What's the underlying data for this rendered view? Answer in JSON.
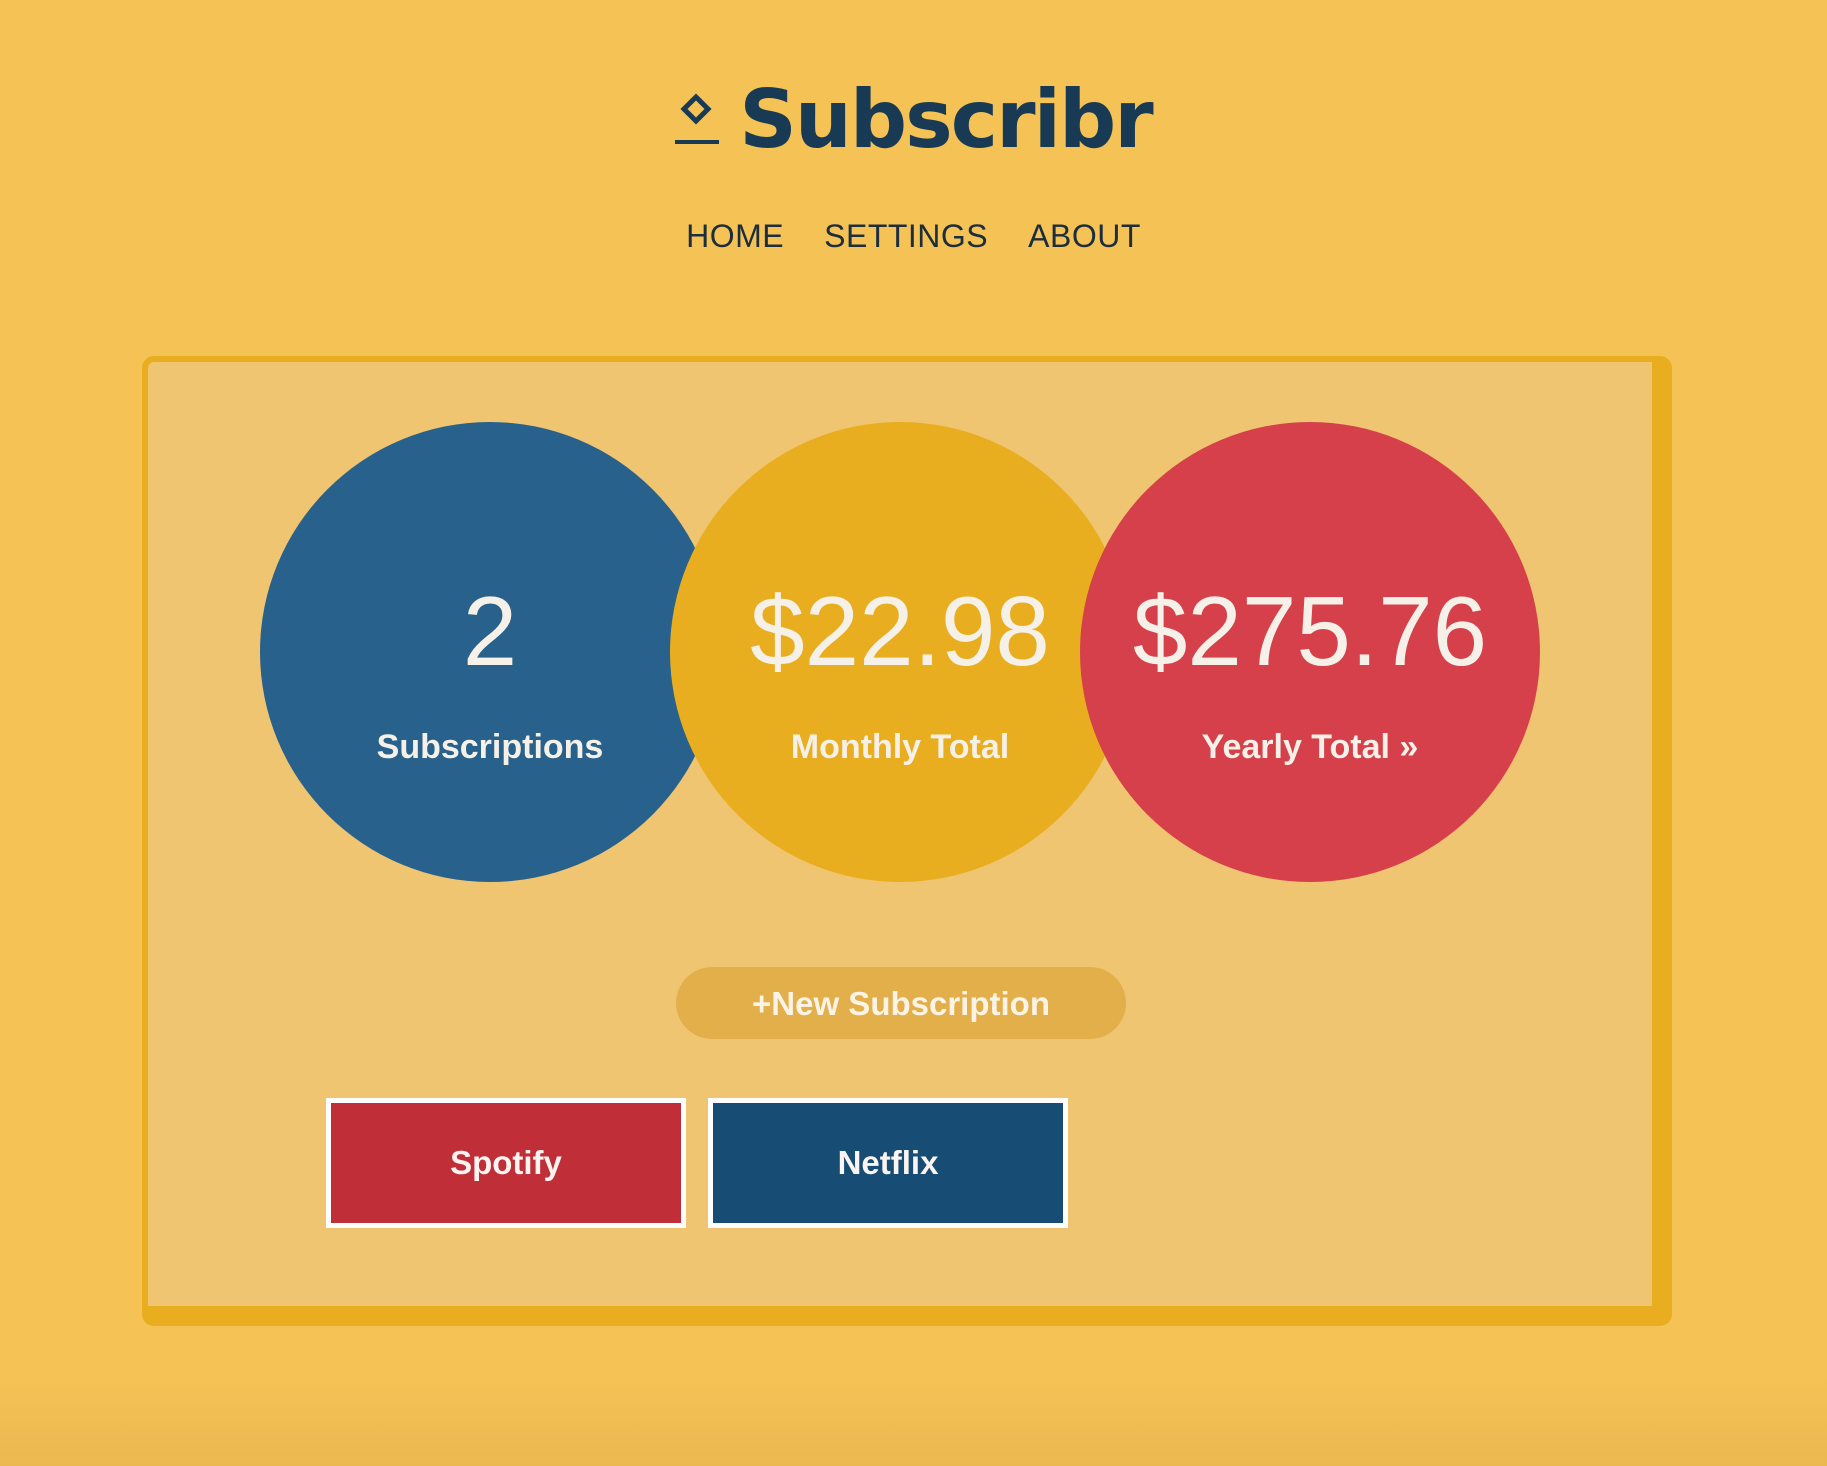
{
  "app": {
    "name": "Subscribr",
    "logo_icon": "diamond-upload-icon"
  },
  "nav": {
    "items": [
      {
        "label": "HOME"
      },
      {
        "label": "SETTINGS"
      },
      {
        "label": "ABOUT"
      }
    ]
  },
  "stats": {
    "subscriptions": {
      "value": "2",
      "label": "Subscriptions",
      "color": "#28618b"
    },
    "monthly": {
      "value": "$22.98",
      "label": "Monthly Total",
      "color": "#e8ae1f"
    },
    "yearly": {
      "value": "$275.76",
      "label": "Yearly Total »",
      "color": "#d6404a"
    }
  },
  "actions": {
    "new_subscription_label": "+New Subscription"
  },
  "subscriptions": [
    {
      "name": "Spotify",
      "color": "#c02e37"
    },
    {
      "name": "Netflix",
      "color": "#174d74"
    }
  ],
  "theme": {
    "background": "#f4c255",
    "panel": "#f0c572",
    "panel_border": "#e9ae20",
    "text_dark": "#183a55"
  }
}
